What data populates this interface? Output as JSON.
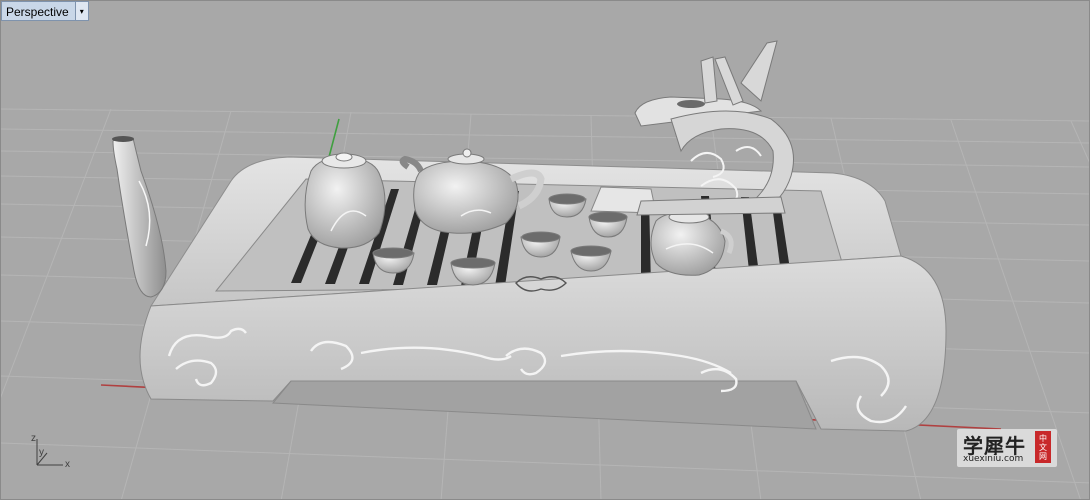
{
  "viewport": {
    "title": "Perspective",
    "menu_glyph": "▾"
  },
  "axis_widget": {
    "z": "z",
    "y": "y",
    "x": "x"
  },
  "watermark": {
    "chinese": "学犀牛",
    "url": "xuexiniu.com",
    "badge_chars": [
      "中",
      "文",
      "网"
    ]
  },
  "colors": {
    "background": "#a8a8a8",
    "grid_minor": "#b4b4b4",
    "grid_major": "#999999",
    "x_axis": "#b04040",
    "y_axis": "#3f9f3f",
    "model": "#dcdcdc"
  }
}
